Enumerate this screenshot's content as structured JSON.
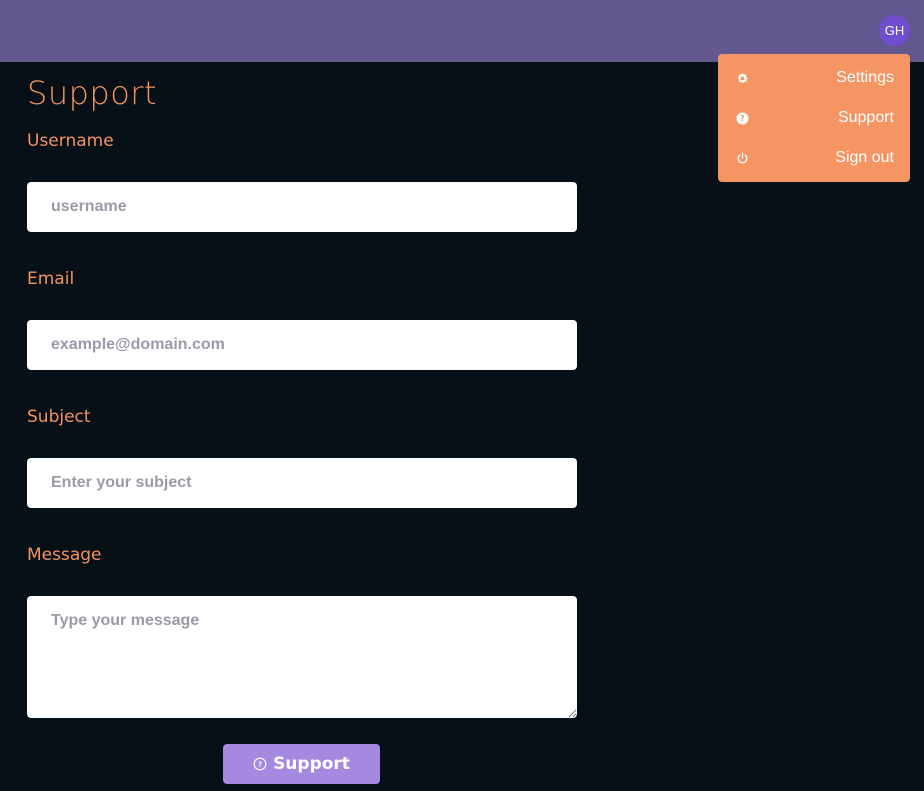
{
  "header": {
    "avatar_initials": "GH",
    "bar_color": "#62578e",
    "avatar_color": "#6f4ed0"
  },
  "dropdown": {
    "color": "#f49563",
    "items": [
      {
        "label": "Settings",
        "icon": "gear-icon"
      },
      {
        "label": "Support",
        "icon": "question-circle-icon"
      },
      {
        "label": "Sign out",
        "icon": "power-icon"
      }
    ]
  },
  "page": {
    "title": "Support",
    "accent": "#f4935f",
    "background": "#070f17"
  },
  "form": {
    "username_label": "Username",
    "username_placeholder": "username",
    "email_label": "Email",
    "email_placeholder": "example@domain.com",
    "subject_label": "Subject",
    "subject_placeholder": "Enter your subject",
    "message_label": "Message",
    "message_placeholder": "Type your message",
    "submit_label": "Support",
    "submit_icon": "question-circle-icon",
    "submit_color": "#a589e0"
  }
}
